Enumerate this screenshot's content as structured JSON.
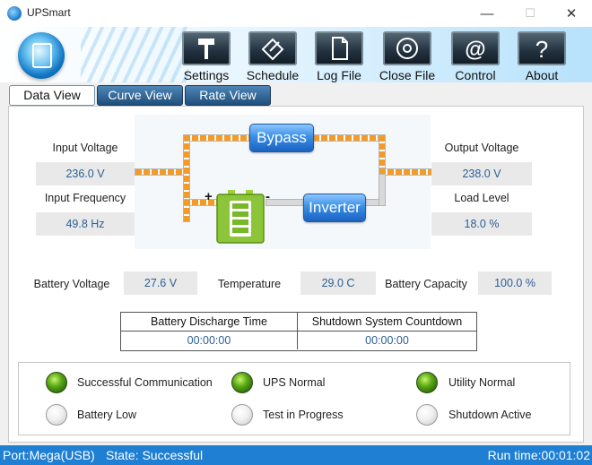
{
  "window": {
    "title": "UPSmart",
    "minimize_glyph": "—",
    "maximize_glyph": "☐",
    "close_glyph": "✕"
  },
  "toolbar": {
    "items": [
      {
        "label": "Settings",
        "icon": "hammer-icon"
      },
      {
        "label": "Schedule",
        "icon": "pen-icon"
      },
      {
        "label": "Log File",
        "icon": "document-icon"
      },
      {
        "label": "Close File",
        "icon": "disc-icon"
      },
      {
        "label": "Control",
        "icon": "at-icon"
      },
      {
        "label": "About",
        "icon": "question-icon"
      }
    ]
  },
  "tabs": [
    {
      "label": "Data View",
      "active": true
    },
    {
      "label": "Curve View",
      "active": false
    },
    {
      "label": "Rate View",
      "active": false
    }
  ],
  "readings": {
    "input_voltage": {
      "label": "Input Voltage",
      "value": "236.0 V"
    },
    "input_frequency": {
      "label": "Input Frequency",
      "value": "49.8 Hz"
    },
    "output_voltage": {
      "label": "Output Voltage",
      "value": "238.0 V"
    },
    "load_level": {
      "label": "Load Level",
      "value": "18.0 %"
    },
    "battery_voltage": {
      "label": "Battery Voltage",
      "value": "27.6 V"
    },
    "temperature": {
      "label": "Temperature",
      "value": "29.0 C"
    },
    "battery_capacity": {
      "label": "Battery Capacity",
      "value": "100.0 %"
    }
  },
  "diagram": {
    "bypass_label": "Bypass",
    "inverter_label": "Inverter",
    "plus": "+",
    "minus": "-"
  },
  "timers": {
    "discharge": {
      "label": "Battery Discharge Time",
      "value": "00:00:00"
    },
    "shutdown": {
      "label": "Shutdown System Countdown",
      "value": "00:00:00"
    }
  },
  "status": [
    {
      "label": "Successful Communication",
      "on": true
    },
    {
      "label": "UPS Normal",
      "on": true
    },
    {
      "label": "Utility Normal",
      "on": true
    },
    {
      "label": "Battery Low",
      "on": false
    },
    {
      "label": "Test in Progress",
      "on": false
    },
    {
      "label": "Shutdown Active",
      "on": false
    }
  ],
  "statusbar": {
    "port": "Port:Mega(USB)",
    "state": "State: Successful",
    "runtime": "Run time:00:01:02"
  },
  "colors": {
    "accent": "#1f7fd3",
    "wire": "#f49a26",
    "value_text": "#2b5f95",
    "led_on": "#5aa916"
  }
}
